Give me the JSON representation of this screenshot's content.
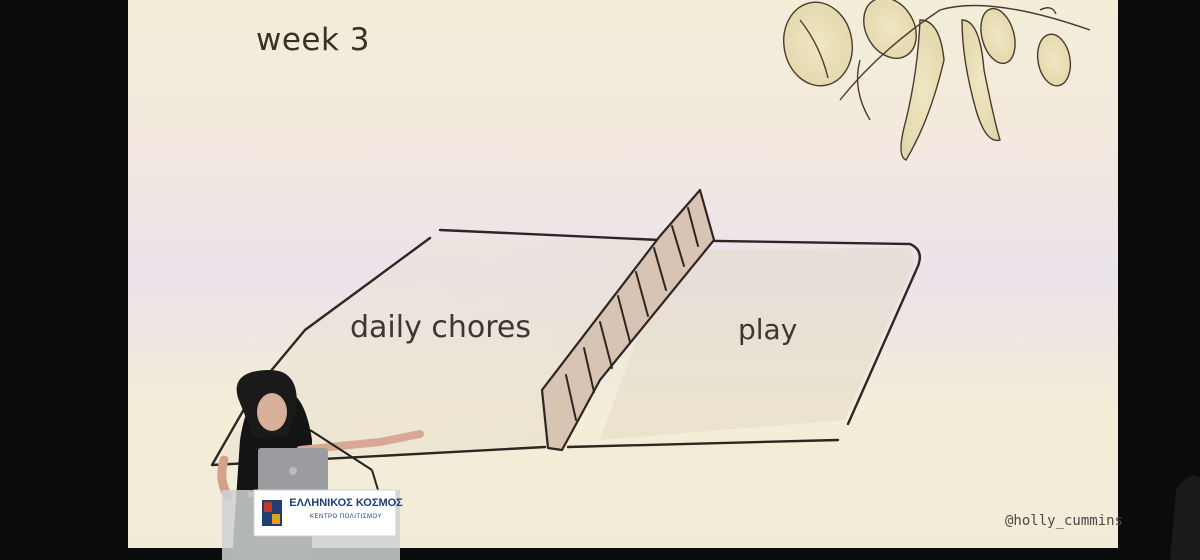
{
  "slide": {
    "title": "week 3",
    "left_label": "daily chores",
    "right_label": "play",
    "handle": "@holly_cummins"
  },
  "podium": {
    "brand": "ΕΛΛΗΝΙΚΟΣ ΚΟΣΜΟΣ",
    "subtitle": "ΚΕΝΤΡΟ ΠΟΛΙΤΙΣΜΟΥ"
  },
  "colors": {
    "stage_background": "#0c0b0b",
    "screen_top": "#f4efd7",
    "screen_mid": "#ece3e8",
    "screen_bottom": "#f5eed2",
    "ink": "#2f2522",
    "podium_blue": "#1f3e72",
    "podium_red": "#c0392b"
  }
}
